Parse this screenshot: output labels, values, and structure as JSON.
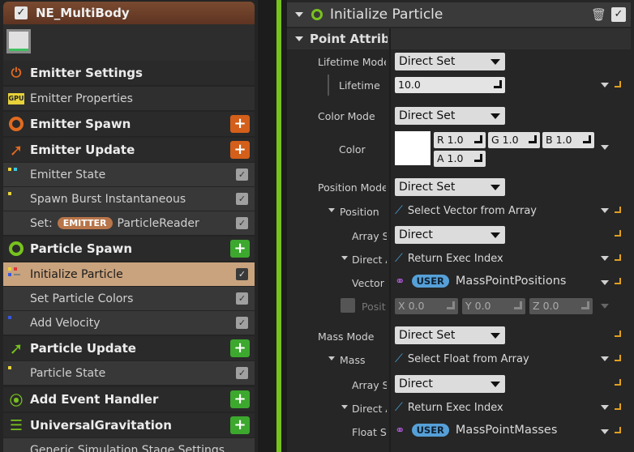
{
  "emitter": {
    "title": "NE_MultiBody"
  },
  "stack": [
    {
      "kind": "section",
      "label": "Emitter Settings",
      "icon": "emitter-settings-icon"
    },
    {
      "kind": "module",
      "label": "Emitter Properties",
      "icon": "gpu-icon",
      "icon_text": "GPU"
    },
    {
      "kind": "section",
      "label": "Emitter Spawn",
      "icon": "ring-icon",
      "add": "orange"
    },
    {
      "kind": "section",
      "label": "Emitter Update",
      "icon": "arrow-up-right-icon",
      "add": "orange"
    },
    {
      "kind": "module",
      "label": "Emitter State"
    },
    {
      "kind": "module",
      "label": "Spawn Burst Instantaneous"
    },
    {
      "kind": "module",
      "label_prefix": "Set:",
      "badge": "EMITTER",
      "label": "ParticleReader"
    },
    {
      "kind": "section",
      "label": "Particle Spawn",
      "icon": "ring-icon",
      "add": "green"
    },
    {
      "kind": "module",
      "label": "Initialize Particle",
      "selected": true
    },
    {
      "kind": "module",
      "label": "Set Particle Colors"
    },
    {
      "kind": "module",
      "label": "Add Velocity"
    },
    {
      "kind": "section",
      "label": "Particle Update",
      "icon": "arrow-up-right-icon",
      "add": "green"
    },
    {
      "kind": "module",
      "label": "Particle State"
    },
    {
      "kind": "section",
      "label": "Add Event Handler",
      "icon": "event-icon",
      "add": "green"
    },
    {
      "kind": "section",
      "label": "UniversalGravitation",
      "icon": "stack-icon",
      "add": "green"
    },
    {
      "kind": "module",
      "label": "Generic Simulation Stage Settings"
    }
  ],
  "panel": {
    "title": "Initialize Particle",
    "category": "Point Attributes",
    "lifetime_mode_label": "Lifetime Mode",
    "lifetime_mode": "Direct Set",
    "lifetime_label": "Lifetime",
    "lifetime": "10.0",
    "color_mode_label": "Color Mode",
    "color_mode": "Direct Set",
    "color_label": "Color",
    "color_swatch": "#ffffff",
    "color": {
      "r_l": "R",
      "r": "1.0",
      "g_l": "G",
      "g": "1.0",
      "b_l": "B",
      "b": "1.0",
      "a_l": "A",
      "a": "1.0"
    },
    "position_mode_label": "Position Mode",
    "position_mode": "Direct Set",
    "position_label": "Position",
    "position_fn": "Select Vector from Array",
    "pos_array_label": "Array Selector",
    "pos_array": "Direct",
    "pos_direct_label": "Direct Array Index",
    "pos_direct_fn": "Return Exec Index",
    "vector_label": "Vector",
    "vector_badge": "USER",
    "vector_value": "MassPointPositions",
    "posit_label": "Position Offset",
    "posit": {
      "x_l": "X",
      "x": "0.0",
      "y_l": "Y",
      "y": "0.0",
      "z_l": "Z",
      "z": "0.0"
    },
    "mass_mode_label": "Mass Mode",
    "mass_mode": "Direct Set",
    "mass_label": "Mass",
    "mass_fn": "Select Float from Array",
    "mass_array_label": "Array Selector",
    "mass_array": "Direct",
    "mass_direct_label": "Direct Array Index",
    "mass_direct_fn": "Return Exec Index",
    "float_label": "Float Selector",
    "float_badge": "USER",
    "float_value": "MassPointMasses"
  },
  "colors": {
    "accent_green": "#78c21e",
    "selected_row": "#c9a37e",
    "add_orange": "#d35f1a",
    "add_green": "#3ca82e",
    "user_badge": "#56a0d8"
  }
}
